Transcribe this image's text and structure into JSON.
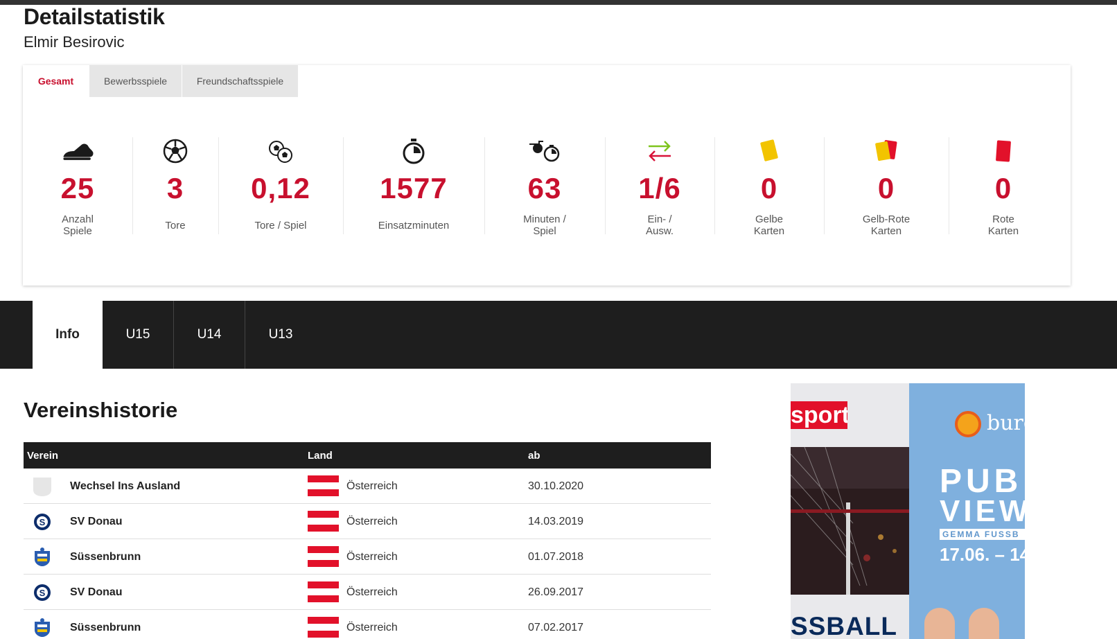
{
  "header": {
    "title": "Detailstatistik",
    "player_name": "Elmir Besirovic"
  },
  "stats_tabs": [
    {
      "label": "Gesamt",
      "active": true
    },
    {
      "label": "Bewerbsspiele",
      "active": false
    },
    {
      "label": "Freundschaftsspiele",
      "active": false
    }
  ],
  "stats": [
    {
      "icon": "boot-icon",
      "value": "25",
      "label": "Anzahl\nSpiele"
    },
    {
      "icon": "ball-icon",
      "value": "3",
      "label": "Tore"
    },
    {
      "icon": "balls-icon",
      "value": "0,12",
      "label": "Tore / Spiel"
    },
    {
      "icon": "stopwatch-icon",
      "value": "1577",
      "label": "Einsatzminuten"
    },
    {
      "icon": "whistle-stopwatch-icon",
      "value": "63",
      "label": "Minuten /\nSpiel"
    },
    {
      "icon": "substitution-arrows-icon",
      "value": "1/6",
      "label": "Ein- /\nAusw."
    },
    {
      "icon": "yellow-card-icon",
      "value": "0",
      "label": "Gelbe\nKarten"
    },
    {
      "icon": "yellow-red-card-icon",
      "value": "0",
      "label": "Gelb-Rote\nKarten"
    },
    {
      "icon": "red-card-icon",
      "value": "0",
      "label": "Rote\nKarten"
    }
  ],
  "nav_tabs": [
    {
      "label": "Info",
      "active": true
    },
    {
      "label": "U15",
      "active": false
    },
    {
      "label": "U14",
      "active": false
    },
    {
      "label": "U13",
      "active": false
    }
  ],
  "history": {
    "title": "Vereinshistorie",
    "columns": [
      "Verein",
      "Land",
      "ab"
    ],
    "rows": [
      {
        "club": "Wechsel Ins Ausland",
        "crest": "blank-crest-icon",
        "country": "Österreich",
        "date": "30.10.2020"
      },
      {
        "club": "SV Donau",
        "crest": "sv-donau-crest-icon",
        "country": "Österreich",
        "date": "14.03.2019"
      },
      {
        "club": "Süssenbrunn",
        "crest": "suessenbrunn-crest-icon",
        "country": "Österreich",
        "date": "01.07.2018"
      },
      {
        "club": "SV Donau",
        "crest": "sv-donau-crest-icon",
        "country": "Österreich",
        "date": "26.09.2017"
      },
      {
        "club": "Süssenbrunn",
        "crest": "suessenbrunn-crest-icon",
        "country": "Österreich",
        "date": "07.02.2017"
      }
    ]
  },
  "ad": {
    "left_brand": "sport",
    "left_bottom": "SSBALL",
    "right_brand": "burg",
    "line1": "PUB",
    "line2": "VIEW",
    "tagline": "GEMMA FUSSB",
    "dates": "17.06. – 14"
  },
  "colors": {
    "accent": "#c8102e",
    "dark": "#1e1e1e"
  }
}
